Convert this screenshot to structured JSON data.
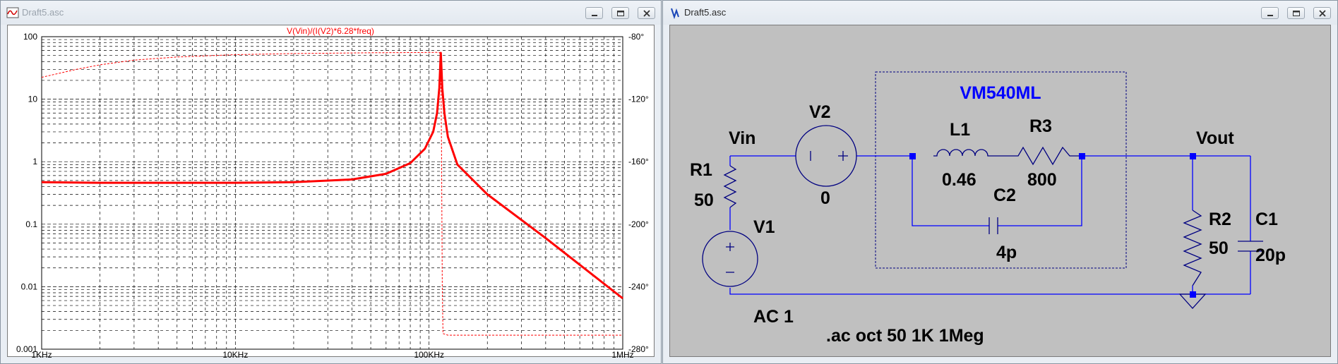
{
  "plot_window": {
    "title": "Draft5.asc",
    "icon": "waveform-icon",
    "controls": [
      "minimize-icon",
      "maximize-icon",
      "close-icon"
    ]
  },
  "schematic_window": {
    "title": "Draft5.asc",
    "icon": "ltspice-icon",
    "controls": [
      "minimize-icon",
      "maximize-icon",
      "close-icon"
    ]
  },
  "chart_data": {
    "type": "line",
    "title": "V(Vin)/(I(V2)*6.28*freq)",
    "xlabel": "",
    "ylabel": "",
    "x_scale": "log",
    "xlim": [
      1000,
      1000000
    ],
    "x_ticks": [
      "1KHz",
      "10KHz",
      "100KHz",
      "1MHz"
    ],
    "y_scale": "log",
    "ylim": [
      0.001,
      100
    ],
    "y_ticks": [
      "100",
      "10",
      "1",
      "0.1",
      "0.01",
      "0.001"
    ],
    "y2lim": [
      -280,
      -80
    ],
    "y2_ticks": [
      "-80°",
      "-120°",
      "-160°",
      "-200°",
      "-240°",
      "-280°"
    ],
    "grid": true,
    "colors": {
      "trace": "#ff0000",
      "grid": "#000000",
      "axis_text": "#000000"
    },
    "series": [
      {
        "style": "solid",
        "axis": "left",
        "x": [
          1000,
          2000,
          5000,
          10000,
          20000,
          40000,
          60000,
          80000,
          95000,
          105000,
          110000,
          113000,
          115000,
          117000,
          120000,
          125000,
          140000,
          200000,
          400000,
          1000000
        ],
        "y": [
          0.47,
          0.46,
          0.46,
          0.46,
          0.47,
          0.52,
          0.64,
          0.95,
          1.6,
          3.0,
          6.0,
          15,
          55,
          15,
          6.0,
          2.5,
          0.9,
          0.3,
          0.06,
          0.0065
        ]
      },
      {
        "style": "dashed",
        "axis": "right",
        "x": [
          1000,
          1500,
          2000,
          3000,
          5000,
          10000,
          20000,
          50000,
          100000,
          113000,
          115000,
          116000,
          117000,
          118000,
          125000,
          200000,
          500000,
          1000000
        ],
        "y": [
          -106,
          -101,
          -98,
          -95,
          -93,
          -91.5,
          -90.8,
          -90.3,
          -90.1,
          -90.0,
          -92,
          -150,
          -240,
          -270,
          -271,
          -271,
          -271,
          -271
        ]
      }
    ]
  },
  "schematic": {
    "labels": {
      "subckt_name": "VM540ML",
      "node_vin": "Vin",
      "node_vout": "Vout",
      "r1_name": "R1",
      "r1_value": "50",
      "v1_name": "V1",
      "v1_value": "AC 1",
      "v2_name": "V2",
      "v2_value": "0",
      "l1_name": "L1",
      "l1_value": "0.46",
      "r3_name": "R3",
      "r3_value": "800",
      "c2_name": "C2",
      "c2_value": "4p",
      "r2_name": "R2",
      "r2_value": "50",
      "c1_name": "C1",
      "c1_value": "20p",
      "directive": ".ac oct 50 1K 1Meg"
    },
    "colors": {
      "wire": "#0000ff",
      "component": "#000080",
      "label": "#000000",
      "subckt_title": "#0000ff",
      "background": "#c0c0c0"
    }
  }
}
